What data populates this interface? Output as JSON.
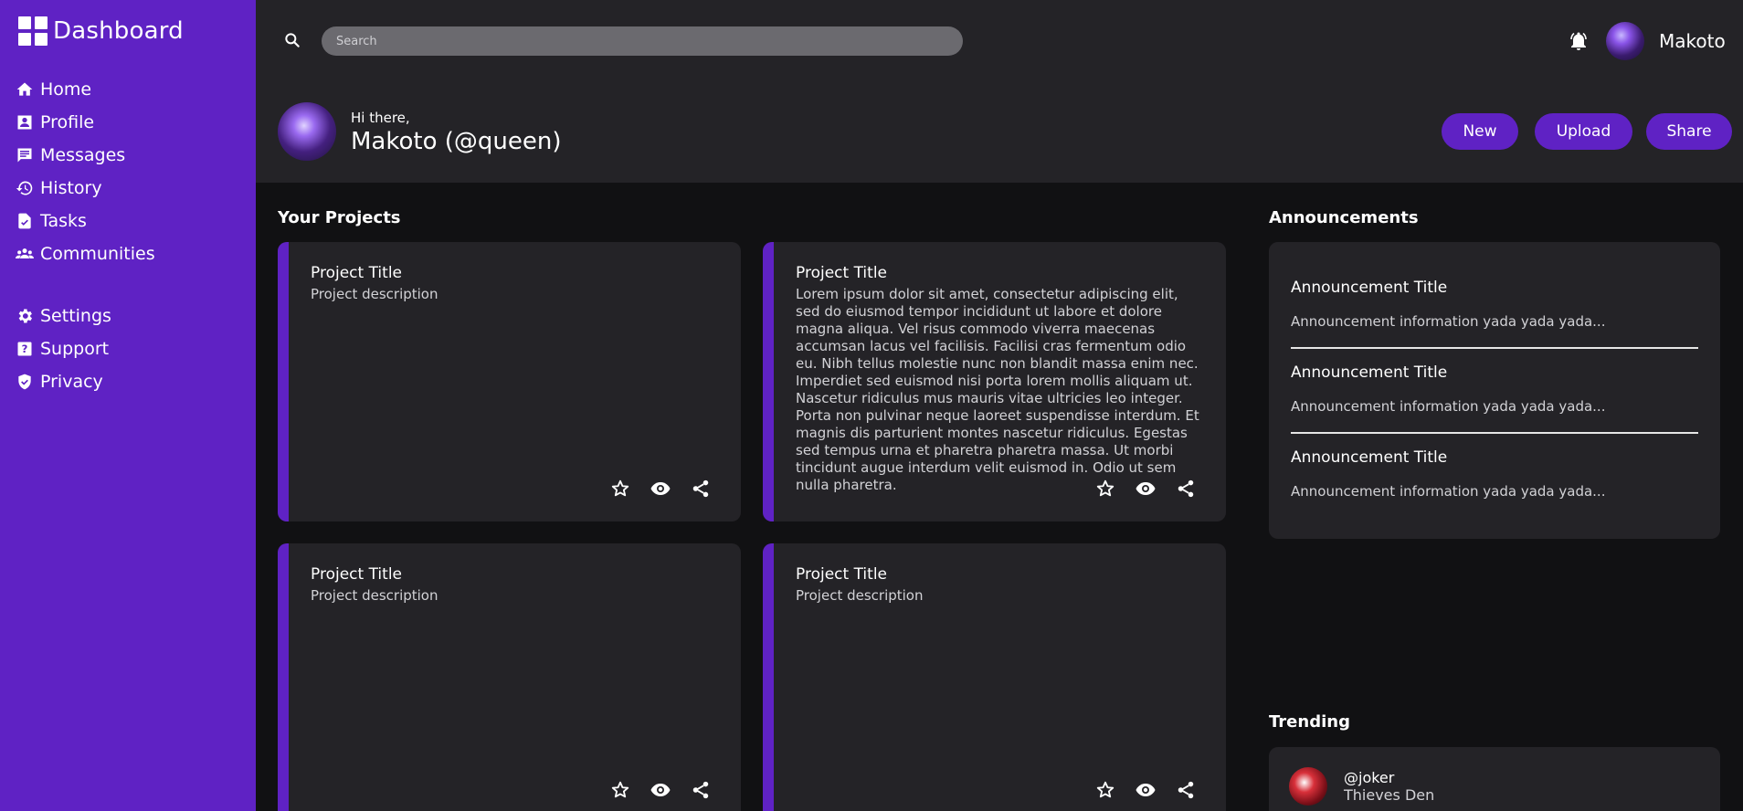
{
  "sidebar": {
    "brand": "Dashboard",
    "items": [
      {
        "label": "Home",
        "icon": "home-icon"
      },
      {
        "label": "Profile",
        "icon": "profile-icon"
      },
      {
        "label": "Messages",
        "icon": "messages-icon"
      },
      {
        "label": "History",
        "icon": "history-icon"
      },
      {
        "label": "Tasks",
        "icon": "tasks-icon"
      },
      {
        "label": "Communities",
        "icon": "communities-icon"
      }
    ],
    "secondary": [
      {
        "label": "Settings",
        "icon": "gear-icon"
      },
      {
        "label": "Support",
        "icon": "help-icon"
      },
      {
        "label": "Privacy",
        "icon": "shield-icon"
      }
    ]
  },
  "topbar": {
    "search_placeholder": "Search",
    "username": "Makoto"
  },
  "header": {
    "greeting": "Hi there,",
    "name": "Makoto (@queen)",
    "buttons": {
      "new": "New",
      "upload": "Upload",
      "share": "Share"
    }
  },
  "projects": {
    "title": "Your Projects",
    "items": [
      {
        "title": "Project Title",
        "description": "Project description"
      },
      {
        "title": "Project Title",
        "description": "Lorem ipsum dolor sit amet, consectetur adipiscing elit, sed do eiusmod tempor incididunt ut labore et dolore magna aliqua. Vel risus commodo viverra maecenas accumsan lacus vel facilisis. Facilisi cras fermentum odio eu. Nibh tellus molestie nunc non blandit massa enim nec. Imperdiet sed euismod nisi porta lorem mollis aliquam ut. Nascetur ridiculus mus mauris vitae ultricies leo integer. Porta non pulvinar neque laoreet suspendisse interdum. Et magnis dis parturient montes nascetur ridiculus. Egestas sed tempus urna et pharetra pharetra massa. Ut morbi tincidunt augue interdum velit euismod in. Odio ut sem nulla pharetra."
      },
      {
        "title": "Project Title",
        "description": "Project description"
      },
      {
        "title": "Project Title",
        "description": "Project description"
      }
    ]
  },
  "announcements": {
    "title": "Announcements",
    "items": [
      {
        "title": "Announcement Title",
        "text": "Announcement information yada yada yada..."
      },
      {
        "title": "Announcement Title",
        "text": "Announcement information yada yada yada..."
      },
      {
        "title": "Announcement Title",
        "text": "Announcement information yada yada yada..."
      }
    ]
  },
  "trending": {
    "title": "Trending",
    "items": [
      {
        "user": "@joker",
        "subtitle": "Thieves Den"
      }
    ]
  },
  "colors": {
    "accent": "#5f22c4",
    "surface": "#242327",
    "background": "#111113"
  }
}
